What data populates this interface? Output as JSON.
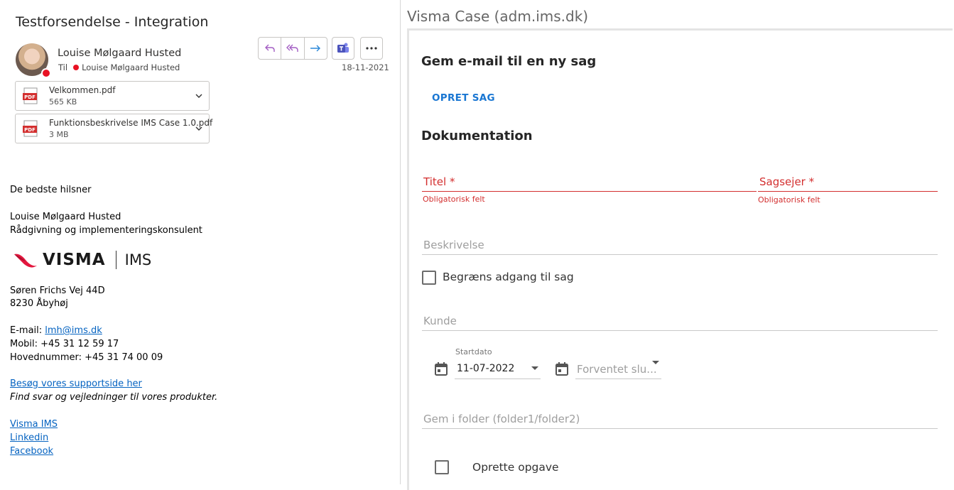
{
  "mail": {
    "subject": "Testforsendelse - Integration",
    "sender_name": "Louise Mølgaard Husted",
    "to_label": "Til",
    "recipient": "Louise Mølgaard Husted",
    "date": "18-11-2021",
    "toolbar_icons": [
      "reply-icon",
      "reply-all-icon",
      "forward-icon",
      "teams-icon",
      "more-icon"
    ],
    "attachments": [
      {
        "name": "Velkommen.pdf",
        "size": "565 KB",
        "badge": "PDF"
      },
      {
        "name": "Funktionsbeskrivelse IMS Case 1.0.pdf",
        "size": "3 MB",
        "badge": "PDF"
      }
    ],
    "signature": {
      "greeting": "De bedste hilsner",
      "name": "Louise Mølgaard Husted",
      "role": "Rådgivning og implementeringskonsulent",
      "logo_word": "VISMA",
      "logo_sub": "IMS",
      "address1": "Søren Frichs Vej 44D",
      "address2": "8230 Åbyhøj",
      "email_label": "E-mail: ",
      "email": "lmh@ims.dk",
      "mobile": "Mobil: +45 31 12 59 17",
      "main_number": "Hovednummer: +45 31 74 00 09",
      "support_link": "Besøg vores supportside her",
      "support_text": "Find svar og vejledninger til vores produkter.",
      "links": [
        "Visma IMS",
        "Linkedin",
        "Facebook"
      ]
    }
  },
  "addin": {
    "title": "Visma Case (adm.ims.dk)",
    "heading_save": "Gem e-mail til en ny sag",
    "create_button": "OPRET SAG",
    "heading_doc": "Dokumentation",
    "title_field": {
      "label": "Titel",
      "required": "*",
      "helper": "Obligatorisk felt"
    },
    "owner_field": {
      "label": "Sagsejer",
      "required": "*",
      "helper": "Obligatorisk felt"
    },
    "description_field": {
      "label": "Beskrivelse"
    },
    "restrict_access_label": "Begræns adgang til sag",
    "restrict_access_checked": false,
    "customer_field": {
      "label": "Kunde"
    },
    "start_date": {
      "label": "Startdato",
      "value": "11-07-2022"
    },
    "end_date": {
      "placeholder": "Forventet slu..."
    },
    "folder_field": {
      "label": "Gem i folder (folder1/folder2)"
    },
    "create_task_label": "Oprette opgave",
    "create_task_checked": false,
    "colors": {
      "accent": "#1976d2",
      "error": "#d32f2f",
      "brand_red": "#e3173e"
    }
  }
}
